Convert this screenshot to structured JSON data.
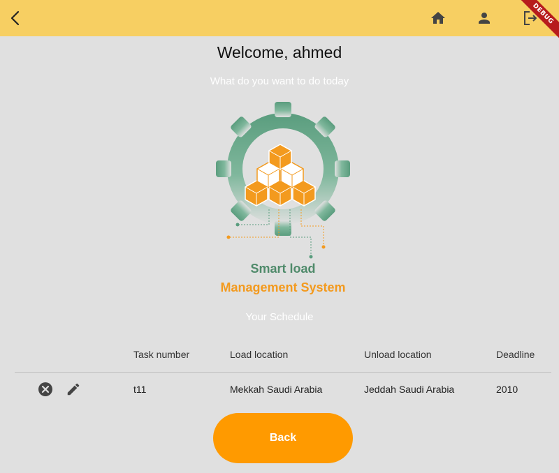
{
  "appbar": {
    "background": "#f7cf62",
    "back_icon": "arrow-back-icon",
    "actions": [
      "home-icon",
      "person-icon",
      "logout-icon"
    ],
    "debug_label": "DEBUG"
  },
  "main": {
    "welcome": "Welcome, ahmed",
    "subtitle": "What do you want to do today",
    "logo": {
      "line1": "Smart load",
      "line2": "Management System",
      "colors": {
        "gear": "#5a9d7e",
        "boxes": "#f39a1e",
        "line1": "#4f8a6a",
        "line2": "#f39a1e"
      }
    },
    "schedule_title": "Your Schedule"
  },
  "table": {
    "columns": [
      "Task number",
      "Load location",
      "Unload location",
      "Deadline"
    ],
    "rows": [
      {
        "task": "t11",
        "load": "Mekkah Saudi Arabia",
        "unload": "Jeddah Saudi Arabia",
        "deadline": "2010",
        "actions": [
          "cancel-icon",
          "edit-icon"
        ]
      }
    ]
  },
  "back_button": {
    "label": "Back",
    "color": "#ff9a00"
  }
}
